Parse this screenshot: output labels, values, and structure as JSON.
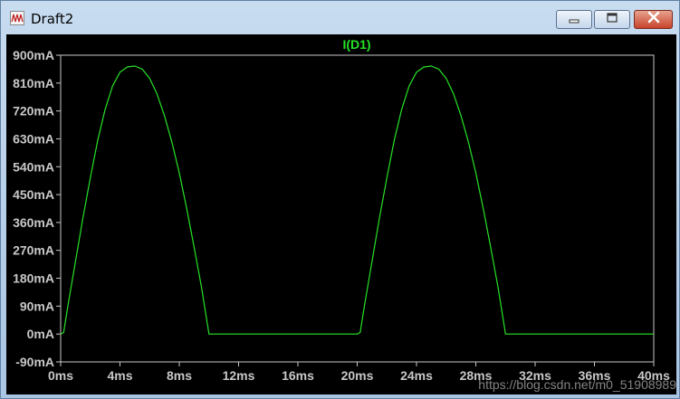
{
  "window": {
    "title": "Draft2",
    "buttons": {
      "minimize": "minimize",
      "maximize": "maximize",
      "close": "close"
    }
  },
  "watermark": "https://blog.csdn.net/m0_51908989",
  "colors": {
    "background": "#000000",
    "trace": "#27e327",
    "axis": "#c8c8c8",
    "frame": "#c8c8c8"
  },
  "chart_data": {
    "type": "line",
    "title": "I(D1)",
    "xlabel": "",
    "ylabel": "",
    "xlim": [
      0,
      40
    ],
    "ylim": [
      -90,
      900
    ],
    "x_unit": "ms",
    "y_unit": "mA",
    "grid": false,
    "xticks": [
      "0ms",
      "4ms",
      "8ms",
      "12ms",
      "16ms",
      "20ms",
      "24ms",
      "28ms",
      "32ms",
      "36ms",
      "40ms"
    ],
    "yticks": [
      "900mA",
      "810mA",
      "720mA",
      "630mA",
      "540mA",
      "450mA",
      "360mA",
      "270mA",
      "180mA",
      "90mA",
      "0mA",
      "-90mA"
    ],
    "series": [
      {
        "name": "I(D1)",
        "x": [
          0,
          0.2,
          0.5,
          1,
          1.5,
          2,
          2.5,
          3,
          3.5,
          4,
          4.5,
          5,
          5.5,
          6,
          6.5,
          7,
          7.5,
          8,
          8.5,
          9,
          9.5,
          9.8,
          10,
          12,
          14,
          16,
          18,
          20,
          20.2,
          20.5,
          21,
          21.5,
          22,
          22.5,
          23,
          23.5,
          24,
          24.5,
          25,
          25.5,
          26,
          26.5,
          27,
          27.5,
          28,
          28.5,
          29,
          29.5,
          29.8,
          30,
          32,
          34,
          36,
          38,
          40
        ],
        "y": [
          0,
          5,
          95,
          235,
          375,
          505,
          625,
          725,
          800,
          845,
          862,
          865,
          855,
          825,
          775,
          705,
          620,
          520,
          405,
          280,
          150,
          60,
          0,
          0,
          0,
          0,
          0,
          0,
          5,
          95,
          235,
          375,
          505,
          625,
          725,
          800,
          845,
          862,
          865,
          855,
          825,
          775,
          705,
          620,
          520,
          405,
          280,
          150,
          60,
          0,
          0,
          0,
          0,
          0,
          0
        ]
      }
    ]
  }
}
